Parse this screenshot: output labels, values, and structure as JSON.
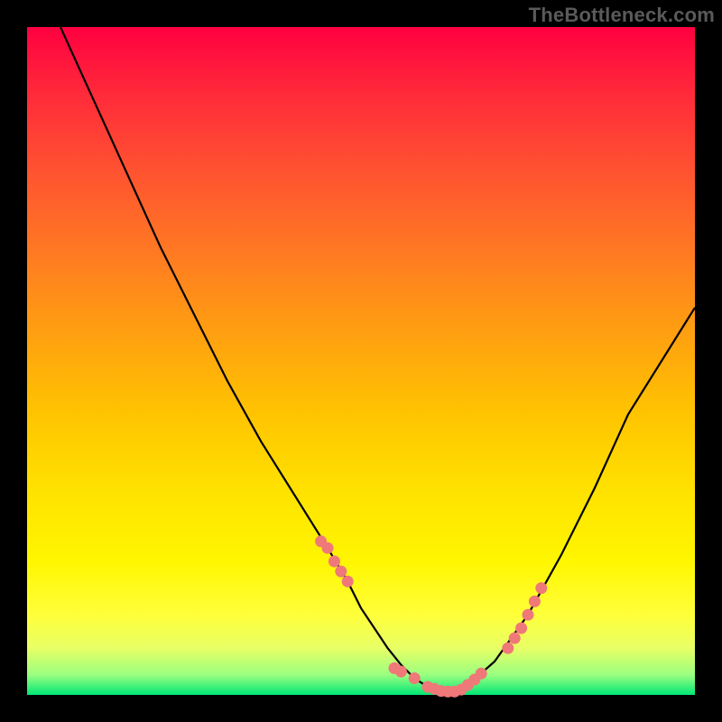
{
  "watermark": "TheBottleneck.com",
  "colors": {
    "background": "#000000",
    "curve": "#000000",
    "dots": "#ef7878",
    "gradient_top": "#ff0040",
    "gradient_bottom": "#00e676"
  },
  "chart_data": {
    "type": "line",
    "title": "",
    "xlabel": "",
    "ylabel": "",
    "xlim": [
      0,
      100
    ],
    "ylim": [
      0,
      100
    ],
    "series": [
      {
        "name": "bottleneck-curve",
        "x": [
          5,
          10,
          15,
          20,
          25,
          30,
          35,
          40,
          45,
          48,
          50,
          52,
          54,
          56,
          58,
          60,
          62,
          64,
          66,
          70,
          75,
          80,
          85,
          90,
          95,
          100
        ],
        "y": [
          100,
          89,
          78,
          67,
          57,
          47,
          38,
          30,
          22,
          17,
          13,
          10,
          7,
          4.5,
          2.5,
          1.2,
          0.5,
          0.5,
          1.5,
          5,
          12,
          21,
          31,
          42,
          50,
          58
        ]
      }
    ],
    "highlight_points": {
      "name": "marked-dots",
      "x": [
        44,
        45,
        46,
        47,
        48,
        55,
        56,
        58,
        60,
        61,
        62,
        63,
        64,
        65,
        66,
        67,
        68,
        72,
        73,
        74,
        75,
        76,
        77
      ],
      "y": [
        23,
        22,
        20,
        18.5,
        17,
        4,
        3.5,
        2.5,
        1.2,
        0.9,
        0.6,
        0.5,
        0.5,
        0.8,
        1.5,
        2.3,
        3.2,
        7,
        8.5,
        10,
        12,
        14,
        16
      ]
    }
  }
}
